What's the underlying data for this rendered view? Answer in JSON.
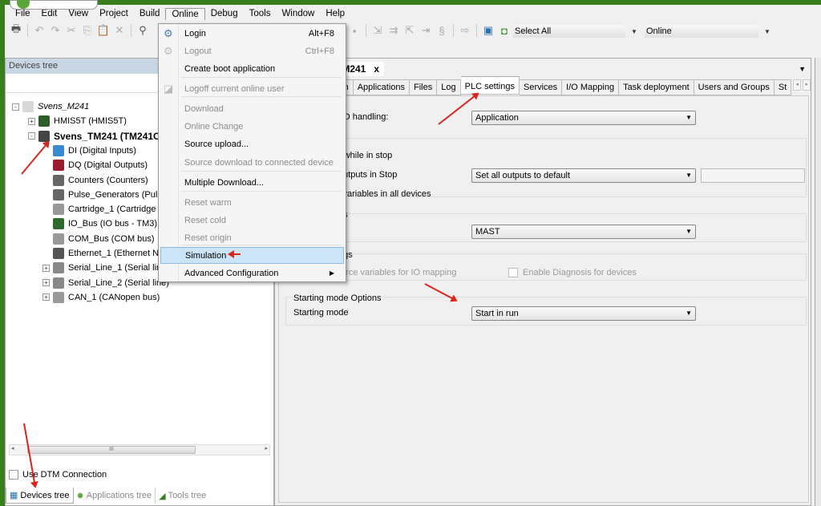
{
  "menubar": [
    "File",
    "Edit",
    "View",
    "Project",
    "Build",
    "Online",
    "Debug",
    "Tools",
    "Window",
    "Help"
  ],
  "toolbar": {
    "select_all": "Select All",
    "mode": "Online"
  },
  "left_panel": {
    "title": "Devices tree",
    "tree": [
      {
        "label": "Svens_M241",
        "level": 0,
        "expander": "-",
        "italic": true,
        "icon_color": "#d8d8d8"
      },
      {
        "label": "HMIS5T (HMIS5T)",
        "level": 1,
        "expander": "+",
        "icon_color": "#2e5e2a"
      },
      {
        "label": "Svens_TM241 (TM241C",
        "level": 1,
        "expander": "-",
        "bold": true,
        "icon_color": "#444"
      },
      {
        "label": "DI (Digital Inputs)",
        "level": 2,
        "icon_color": "#3b8ad0"
      },
      {
        "label": "DQ (Digital Outputs)",
        "level": 2,
        "icon_color": "#9b1b2e"
      },
      {
        "label": "Counters (Counters)",
        "level": 2,
        "icon_color": "#666"
      },
      {
        "label": "Pulse_Generators (Puls",
        "level": 2,
        "icon_color": "#666"
      },
      {
        "label": "Cartridge_1 (Cartridge",
        "level": 2,
        "icon_color": "#999"
      },
      {
        "label": "IO_Bus (IO bus - TM3)",
        "level": 2,
        "icon_color": "#2d6a2d"
      },
      {
        "label": "COM_Bus (COM bus)",
        "level": 2,
        "icon_color": "#999"
      },
      {
        "label": "Ethernet_1 (Ethernet N",
        "level": 2,
        "icon_color": "#555"
      },
      {
        "label": "Serial_Line_1 (Serial lin",
        "level": 2,
        "expander": "+",
        "icon_color": "#888"
      },
      {
        "label": "Serial_Line_2 (Serial line)",
        "level": 2,
        "expander": "+",
        "icon_color": "#888"
      },
      {
        "label": "CAN_1 (CANopen bus)",
        "level": 2,
        "expander": "+",
        "icon_color": "#999"
      }
    ],
    "use_dtm": "Use DTM Connection",
    "bottom_tabs": [
      "Devices tree",
      "Applications tree",
      "Tools tree"
    ]
  },
  "online_menu": [
    {
      "label": "Login",
      "shortcut": "Alt+F8",
      "disabled": false
    },
    {
      "label": "Logout",
      "shortcut": "Ctrl+F8",
      "disabled": true
    },
    {
      "label": "Create boot application",
      "disabled": false
    },
    {
      "label": "Logoff current online user",
      "disabled": true
    },
    {
      "label": "Download",
      "disabled": true
    },
    {
      "label": "Online Change",
      "disabled": true
    },
    {
      "label": "Source upload...",
      "disabled": false
    },
    {
      "label": "Source download to connected device",
      "disabled": true
    },
    {
      "label": "Multiple Download...",
      "disabled": false
    },
    {
      "label": "Reset warm",
      "disabled": true
    },
    {
      "label": "Reset cold",
      "disabled": true
    },
    {
      "label": "Reset origin",
      "disabled": true
    },
    {
      "label": "Simulation",
      "disabled": false,
      "highlighted": true
    },
    {
      "label": "Advanced Configuration",
      "disabled": false,
      "submenu": true
    }
  ],
  "editor": {
    "doc_tab": "TM241",
    "close": "x",
    "tabs": [
      "ion",
      "Applications",
      "Files",
      "Log",
      "PLC settings",
      "Services",
      "I/O Mapping",
      "Task deployment",
      "Users and Groups",
      "St"
    ],
    "active_tab": "PLC settings",
    "io_handling_label": "I/O handling:",
    "io_handling_value": "Application",
    "update_io_stop": ") while in stop",
    "outputs_stop_label": "outputs in Stop",
    "outputs_stop_value": "Set all outputs to default",
    "vars_all_devices": "l variables in all devices",
    "bus_cycle_group": "ns",
    "bus_cycle_value": "MAST",
    "additional_group": "ngs",
    "force_vars": "force variables for IO mapping",
    "enable_diag": "Enable Diagnosis for devices",
    "starting_group": "Starting mode Options",
    "starting_label": "Starting mode",
    "starting_value": "Start in run"
  },
  "annotation_color": "#d9261c"
}
